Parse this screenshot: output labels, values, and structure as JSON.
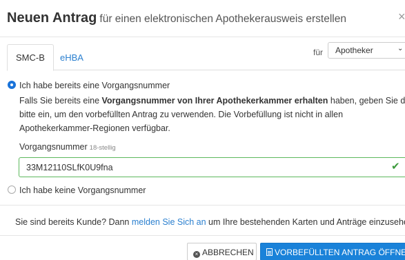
{
  "header": {
    "title_strong": "Neuen Antrag",
    "title_rest": "für einen elektronischen Apothekerausweis erstellen",
    "close_label": "×"
  },
  "tabs": [
    {
      "label": "SMC-B",
      "active": true
    },
    {
      "label": "eHBA",
      "active": false
    }
  ],
  "role_select": {
    "prefix": "für",
    "value": "Apotheker"
  },
  "option_existing": {
    "label": "Ich habe bereits eine Vorgangsnummer",
    "selected": true,
    "text_before_bold": "Falls Sie bereits eine ",
    "text_bold": "Vorgangsnummer von Ihrer Apothekerkammer erhalten",
    "text_after_bold": " haben, geben Sie diese",
    "line2": "bitte ein, um den vorbefüllten Antrag zu verwenden. Die Vorbefüllung ist nicht in allen",
    "line3": "Apothekerkammer-Regionen verfügbar."
  },
  "vorgangsnummer": {
    "label": "Vorgangsnummer",
    "hint": "18-stellig",
    "value": "33M12110SLfK0U9fna",
    "valid": true
  },
  "option_none": {
    "label": "Ich habe keine Vorgangsnummer",
    "selected": false
  },
  "info": {
    "before_link": "Sie sind bereits Kunde? Dann ",
    "link": "melden Sie Sich an",
    "after_link": " um Ihre bestehenden Karten und Anträge einzusehen."
  },
  "footer": {
    "cancel_label": "ABBRECHEN",
    "submit_label": "VORBEFÜLLTEN ANTRAG ÖFFNEN"
  },
  "colors": {
    "accent": "#1a82d9",
    "valid": "#5cb85c",
    "link": "#2a7fcf"
  }
}
